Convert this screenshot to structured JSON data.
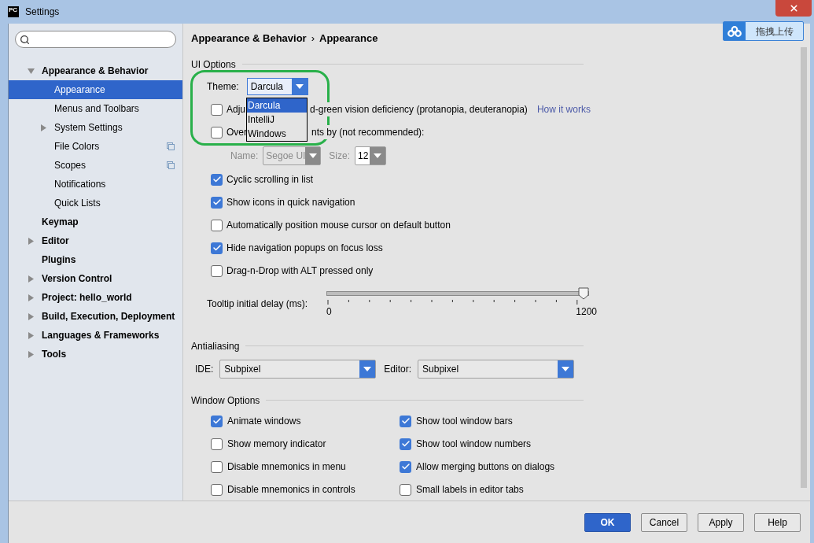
{
  "window": {
    "title": "Settings",
    "app_icon": "PC"
  },
  "overlay_button": {
    "label": "拖拽上传"
  },
  "sidebar": {
    "items": [
      {
        "label": "Appearance & Behavior",
        "expanded": true,
        "selected": false,
        "children": [
          {
            "label": "Appearance",
            "selected": true
          },
          {
            "label": "Menus and Toolbars",
            "selected": false
          },
          {
            "label": "System Settings",
            "expanded": false,
            "selected": false
          },
          {
            "label": "File Colors",
            "selected": false,
            "project_level": true
          },
          {
            "label": "Scopes",
            "selected": false,
            "project_level": true
          },
          {
            "label": "Notifications",
            "selected": false
          },
          {
            "label": "Quick Lists",
            "selected": false
          }
        ]
      },
      {
        "label": "Keymap",
        "selected": false
      },
      {
        "label": "Editor",
        "expanded": false,
        "selected": false
      },
      {
        "label": "Plugins",
        "selected": false
      },
      {
        "label": "Version Control",
        "expanded": false,
        "selected": false
      },
      {
        "label": "Project: hello_world",
        "expanded": false,
        "selected": false
      },
      {
        "label": "Build, Execution, Deployment",
        "expanded": false,
        "selected": false
      },
      {
        "label": "Languages & Frameworks",
        "expanded": false,
        "selected": false
      },
      {
        "label": "Tools",
        "expanded": false,
        "selected": false
      }
    ]
  },
  "breadcrumb": {
    "parts": [
      "Appearance & Behavior",
      "Appearance"
    ],
    "separator": "›"
  },
  "ui_options": {
    "title": "UI Options",
    "theme": {
      "label": "Theme:",
      "value": "Darcula",
      "options": [
        {
          "label": "Darcula",
          "selected": true
        },
        {
          "label": "IntelliJ",
          "selected": false
        },
        {
          "label": "Windows",
          "selected": false
        }
      ]
    },
    "rows": [
      {
        "kind": "checkbox",
        "checked": false,
        "label_parts": [
          "Adju",
          "d-green vision deficiency (protanopia, deuteranopia)"
        ],
        "link": "How it works"
      },
      {
        "kind": "checkbox",
        "checked": false,
        "label_parts": [
          "Over",
          "nts by (not recommended):"
        ]
      },
      {
        "kind": "font",
        "disabled": true,
        "name_label": "Name:",
        "name_value": "Segoe UI",
        "size_label": "Size:",
        "size_value": "12"
      },
      {
        "kind": "checkbox",
        "checked": true,
        "label_parts": [
          "Cyclic scrolling in list"
        ]
      },
      {
        "kind": "checkbox",
        "checked": true,
        "label_parts": [
          "Show icons in quick navigation"
        ]
      },
      {
        "kind": "checkbox",
        "checked": false,
        "label_parts": [
          "Automatically position mouse cursor on default button"
        ]
      },
      {
        "kind": "checkbox",
        "checked": true,
        "label_parts": [
          "Hide navigation popups on focus loss"
        ]
      },
      {
        "kind": "checkbox",
        "checked": false,
        "label_parts": [
          "Drag-n-Drop with ALT pressed only"
        ]
      },
      {
        "kind": "slider",
        "label": "Tooltip initial delay (ms):",
        "level": 1,
        "min": "0",
        "max": "1200"
      }
    ]
  },
  "antialiasing": {
    "title": "Antialiasing",
    "combos": [
      {
        "label": "IDE:",
        "value": "Subpixel"
      },
      {
        "label": "Editor:",
        "value": "Subpixel"
      }
    ]
  },
  "window_options": {
    "title": "Window Options",
    "columns": [
      [
        {
          "label": "Animate windows",
          "checked": true
        },
        {
          "label": "Show memory indicator",
          "checked": false
        },
        {
          "label": "Disable mnemonics in menu",
          "checked": false
        },
        {
          "label": "Disable mnemonics in controls",
          "checked": false
        }
      ],
      [
        {
          "label": "Show tool window bars",
          "checked": true
        },
        {
          "label": "Show tool window numbers",
          "checked": true
        },
        {
          "label": "Allow merging buttons on dialogs",
          "checked": true
        },
        {
          "label": "Small labels in editor tabs",
          "checked": false
        }
      ]
    ]
  },
  "buttons": [
    {
      "label": "OK",
      "default": true
    },
    {
      "label": "Cancel",
      "default": false
    },
    {
      "label": "Apply",
      "default": false
    },
    {
      "label": "Help",
      "default": false
    }
  ]
}
